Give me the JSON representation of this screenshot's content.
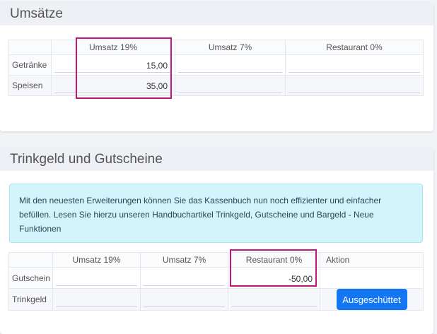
{
  "umsaetze": {
    "title": "Umsätze",
    "columns": [
      "",
      "Umsatz 19%",
      "Umsatz 7%",
      "Restaurant 0%"
    ],
    "rows": [
      {
        "label": "Getränke",
        "values": [
          "15,00",
          "",
          ""
        ]
      },
      {
        "label": "Speisen",
        "values": [
          "35,00",
          "",
          ""
        ]
      }
    ]
  },
  "trinkgeld": {
    "title": "Trinkgeld und Gutscheine",
    "info_text": "Mit den neuesten Erweiterungen können Sie das Kassenbuch nun noch effizienter und einfacher befüllen. Lesen Sie hierzu unseren Handbuchartikel Trinkgeld, Gutscheine und Bargeld - Neue Funktionen",
    "columns": [
      "",
      "Umsatz 19%",
      "Umsatz 7%",
      "Restaurant 0%",
      "Aktion"
    ],
    "rows": [
      {
        "label": "Gutschein",
        "values": [
          "",
          "",
          "-50,00"
        ]
      },
      {
        "label": "Trinkgeld",
        "values": [
          "",
          "",
          ""
        ],
        "action_label": "Ausgeschüttet"
      }
    ]
  },
  "colors": {
    "highlight": "#c0177a",
    "button": "#1576f2",
    "info_bg": "#d3f4fb"
  }
}
